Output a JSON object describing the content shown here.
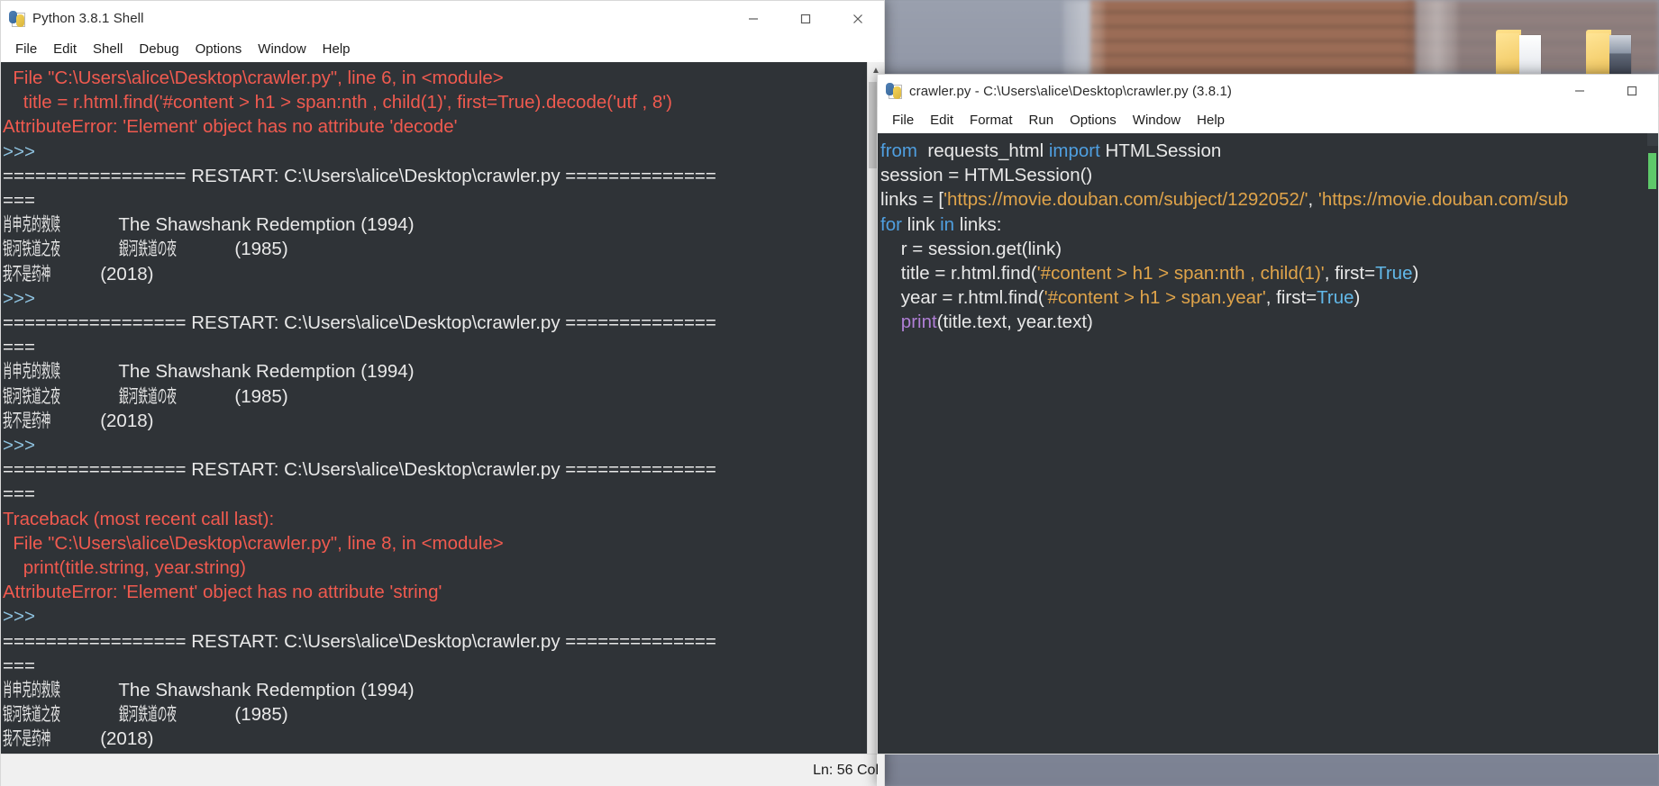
{
  "desktop": {
    "icons": [
      {
        "name": "folder-documents",
        "type": "folder-pages"
      },
      {
        "name": "folder-pictures",
        "type": "folder-photo"
      }
    ]
  },
  "shell": {
    "title": "Python 3.8.1 Shell",
    "icon": "python-idle-icon",
    "menus": [
      "File",
      "Edit",
      "Shell",
      "Debug",
      "Options",
      "Window",
      "Help"
    ],
    "window_buttons": {
      "minimize": "–",
      "maximize": "□",
      "close": "✕"
    },
    "status": "Ln: 56  Col",
    "lines": [
      {
        "kind": "err",
        "text": "  File \"C:\\Users\\alice\\Desktop\\crawler.py\", line 6, in <module>"
      },
      {
        "kind": "err",
        "text": "    title = r.html.find('#content > h1 > span:nth , child(1)', first=True).decode('utf , 8')"
      },
      {
        "kind": "err",
        "text": "AttributeError: 'Element' object has no attribute 'decode'"
      },
      {
        "kind": "prompt",
        "text": ">>> "
      },
      {
        "kind": "out",
        "text": "================= RESTART: C:\\Users\\alice\\Desktop\\crawler.py =============="
      },
      {
        "kind": "out",
        "text": "==="
      },
      {
        "kind": "cjk",
        "cjk": "肖申克的救赎",
        "text": " The Shawshank Redemption (1994)"
      },
      {
        "kind": "cjk2",
        "cjk": "银河铁道之夜",
        "cjk2": "銀河鉄道の夜",
        "text": " (1985)"
      },
      {
        "kind": "cjk",
        "cjk": "我不是药神",
        "text": " (2018)"
      },
      {
        "kind": "prompt",
        "text": ">>> "
      },
      {
        "kind": "out",
        "text": "================= RESTART: C:\\Users\\alice\\Desktop\\crawler.py =============="
      },
      {
        "kind": "out",
        "text": "==="
      },
      {
        "kind": "cjk",
        "cjk": "肖申克的救赎",
        "text": " The Shawshank Redemption (1994)"
      },
      {
        "kind": "cjk2",
        "cjk": "银河铁道之夜",
        "cjk2": "銀河鉄道の夜",
        "text": " (1985)"
      },
      {
        "kind": "cjk",
        "cjk": "我不是药神",
        "text": " (2018)"
      },
      {
        "kind": "prompt",
        "text": ">>> "
      },
      {
        "kind": "out",
        "text": "================= RESTART: C:\\Users\\alice\\Desktop\\crawler.py =============="
      },
      {
        "kind": "out",
        "text": "==="
      },
      {
        "kind": "err",
        "text": "Traceback (most recent call last):"
      },
      {
        "kind": "err",
        "text": "  File \"C:\\Users\\alice\\Desktop\\crawler.py\", line 8, in <module>"
      },
      {
        "kind": "err",
        "text": "    print(title.string, year.string)"
      },
      {
        "kind": "err",
        "text": "AttributeError: 'Element' object has no attribute 'string'"
      },
      {
        "kind": "prompt",
        "text": ">>> "
      },
      {
        "kind": "out",
        "text": "================= RESTART: C:\\Users\\alice\\Desktop\\crawler.py =============="
      },
      {
        "kind": "out",
        "text": "==="
      },
      {
        "kind": "cjk",
        "cjk": "肖申克的救赎",
        "text": " The Shawshank Redemption (1994)"
      },
      {
        "kind": "cjk2",
        "cjk": "银河铁道之夜",
        "cjk2": "銀河鉄道の夜",
        "text": " (1985)"
      },
      {
        "kind": "cjk",
        "cjk": "我不是药神",
        "text": " (2018)"
      },
      {
        "kind": "prompt",
        "text": ">>> "
      }
    ]
  },
  "editor": {
    "title": "crawler.py - C:\\Users\\alice\\Desktop\\crawler.py (3.8.1)",
    "icon": "python-idle-icon",
    "menus": [
      "File",
      "Edit",
      "Format",
      "Run",
      "Options",
      "Window",
      "Help"
    ],
    "window_buttons": {
      "minimize": "–",
      "maximize": "□"
    },
    "code": [
      [
        {
          "t": "from ",
          "c": "kw"
        },
        {
          "t": " requests_html ",
          "c": ""
        },
        {
          "t": "import",
          "c": "kw"
        },
        {
          "t": " HTMLSession",
          "c": ""
        }
      ],
      [
        {
          "t": "session = HTMLSession()",
          "c": ""
        }
      ],
      [
        {
          "t": "links = [",
          "c": ""
        },
        {
          "t": "'https://movie.douban.com/subject/1292052/'",
          "c": "str"
        },
        {
          "t": ", ",
          "c": ""
        },
        {
          "t": "'https://movie.douban.com/sub",
          "c": "str"
        }
      ],
      [
        {
          "t": "for",
          "c": "kw"
        },
        {
          "t": " link ",
          "c": ""
        },
        {
          "t": "in",
          "c": "kw"
        },
        {
          "t": " links:",
          "c": ""
        }
      ],
      [
        {
          "t": "    r = session.get(link)",
          "c": ""
        }
      ],
      [
        {
          "t": "    title = r.html.find(",
          "c": ""
        },
        {
          "t": "'#content > h1 > span:nth , child(1)'",
          "c": "str"
        },
        {
          "t": ", first=",
          "c": ""
        },
        {
          "t": "True",
          "c": "bi"
        },
        {
          "t": ")",
          "c": ""
        }
      ],
      [
        {
          "t": "    year = r.html.find(",
          "c": ""
        },
        {
          "t": "'#content > h1 > span.year'",
          "c": "str"
        },
        {
          "t": ", first=",
          "c": ""
        },
        {
          "t": "True",
          "c": "bi"
        },
        {
          "t": ")",
          "c": ""
        }
      ],
      [
        {
          "t": "    ",
          "c": ""
        },
        {
          "t": "print",
          "c": "fn"
        },
        {
          "t": "(title.text, year.text)",
          "c": ""
        }
      ]
    ]
  },
  "colors": {
    "console_bg": "#2f3337",
    "error_text": "#f05a4f",
    "prompt_text": "#8fc3e0",
    "output_text": "#e9e9e9",
    "keyword": "#4f9fe0",
    "string": "#e0a44a",
    "builtin": "#62b8e8",
    "function": "#b07fd6",
    "scrollbar_thumb": "#5ec96a"
  }
}
